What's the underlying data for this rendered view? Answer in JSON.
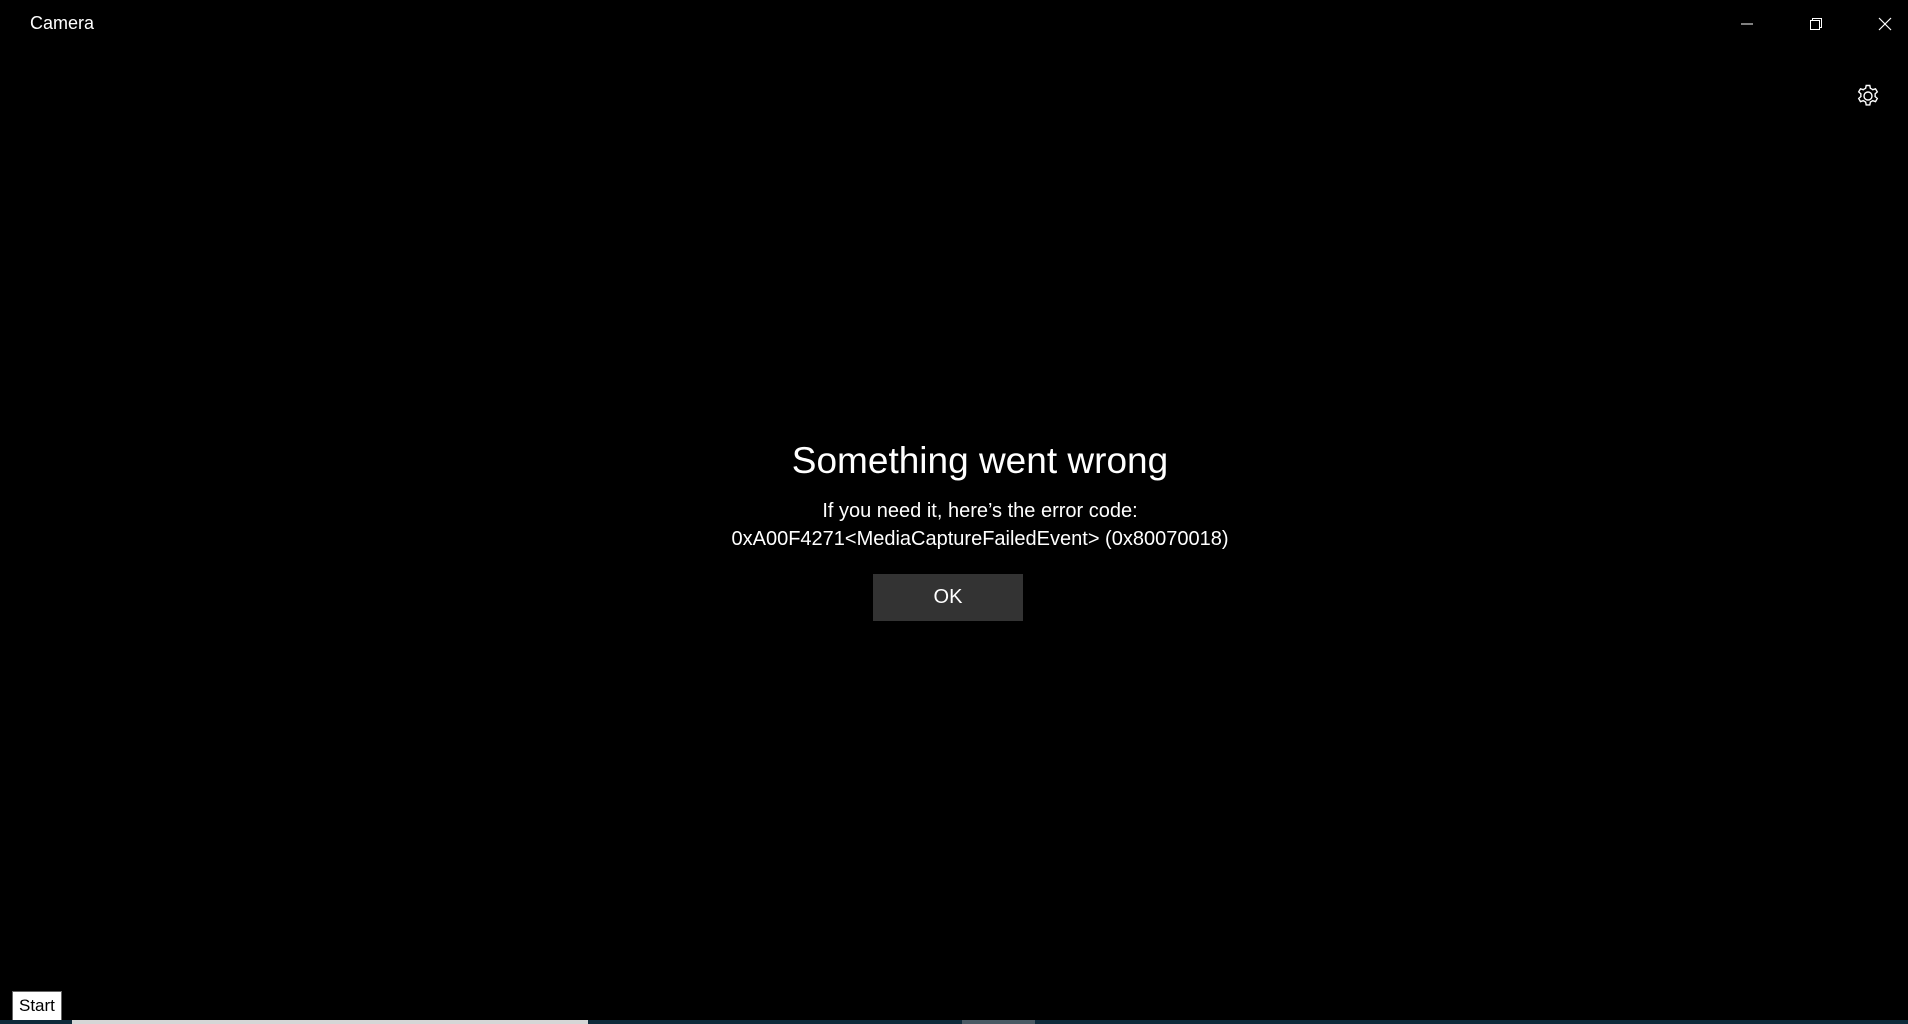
{
  "window": {
    "title": "Camera"
  },
  "titlebar_buttons": {
    "minimize_icon": "minimize-icon",
    "restore_icon": "restore-icon",
    "close_icon": "close-icon"
  },
  "settings": {
    "icon": "gear-icon"
  },
  "error_dialog": {
    "title": "Something went wrong",
    "message_line1": "If you need it, here’s the error code:",
    "message_line2": "0xA00F4271<MediaCaptureFailedEvent> (0x80070018)",
    "ok_label": "OK"
  },
  "taskbar": {
    "start_label": "Start"
  }
}
